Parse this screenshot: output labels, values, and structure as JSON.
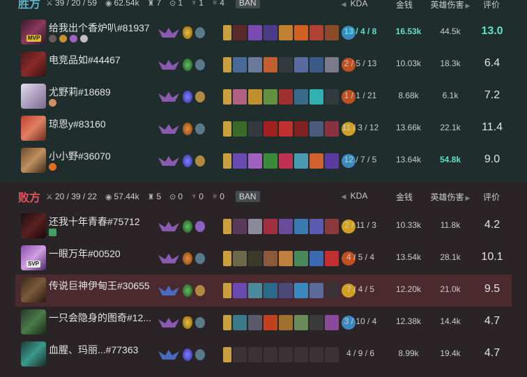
{
  "win": {
    "label": "胜方",
    "kda": "39 / 20 / 59",
    "gold": "62.54k",
    "towers": "7",
    "inhib": "1",
    "baron": "1",
    "dragon": "4",
    "ban": "BAN",
    "cols": {
      "kda": "KDA",
      "gold": "金钱",
      "dmg": "英雄伤害",
      "score": "评价"
    },
    "players": [
      {
        "name": "给我出个香炉叭#81937",
        "badge": "MVP",
        "kda": "13 / 4 / 8",
        "gold": "16.53k",
        "dmg": "44.5k",
        "score": "13.0"
      },
      {
        "name": "电竞品如#44467",
        "badge": "",
        "kda": "2 / 5 / 13",
        "gold": "10.03k",
        "dmg": "18.3k",
        "score": "6.4"
      },
      {
        "name": "尤野莉#18689",
        "badge": "",
        "kda": "1 / 1 / 21",
        "gold": "8.68k",
        "dmg": "6.1k",
        "score": "7.2"
      },
      {
        "name": "琼恩y#83160",
        "badge": "",
        "kda": "11 / 3 / 12",
        "gold": "13.66k",
        "dmg": "22.1k",
        "score": "11.4"
      },
      {
        "name": "小小野#36070",
        "badge": "",
        "kda": "12 / 7 / 5",
        "gold": "13.64k",
        "dmg": "54.8k",
        "score": "9.0"
      }
    ]
  },
  "lose": {
    "label": "败方",
    "kda": "20 / 39 / 22",
    "gold": "57.44k",
    "towers": "5",
    "inhib": "0",
    "baron": "0",
    "dragon": "0",
    "ban": "BAN",
    "cols": {
      "kda": "KDA",
      "gold": "金钱",
      "dmg": "英雄伤害",
      "score": "评价"
    },
    "players": [
      {
        "name": "还我十年青春#75712",
        "badge": "",
        "kda": "2 / 11 / 3",
        "gold": "10.33k",
        "dmg": "11.8k",
        "score": "4.2"
      },
      {
        "name": "一眼万年#00520",
        "badge": "SVP",
        "kda": "4 / 5 / 4",
        "gold": "13.54k",
        "dmg": "28.1k",
        "score": "10.1"
      },
      {
        "name": "传说巨神伊甸王#30655",
        "badge": "",
        "kda": "7 / 4 / 5",
        "gold": "12.20k",
        "dmg": "21.0k",
        "score": "9.5"
      },
      {
        "name": "一只会隐身的图奇#12...",
        "badge": "",
        "kda": "3 / 10 / 4",
        "gold": "12.38k",
        "dmg": "14.4k",
        "score": "4.7"
      },
      {
        "name": "血腥、玛丽...#77363",
        "badge": "",
        "kda": "4 / 9 / 6",
        "gold": "8.99k",
        "dmg": "19.4k",
        "score": "4.7"
      }
    ]
  },
  "colors": {
    "win_label": "#5fb0c8",
    "lose_label": "#e0555a",
    "highlight": "#5fe0c8",
    "lose_row_highlight": "#4a2a2e"
  }
}
